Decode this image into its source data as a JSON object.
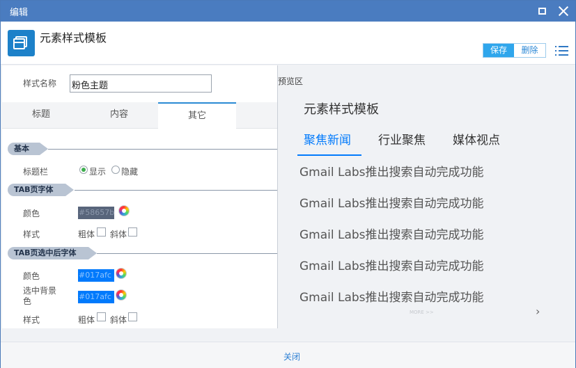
{
  "window": {
    "title": "编辑"
  },
  "header": {
    "title": "元素样式模板",
    "save_label": "保存",
    "delete_label": "删除"
  },
  "form": {
    "name_label": "样式名称",
    "name_value": "粉色主题"
  },
  "tabs": [
    {
      "label": "标题"
    },
    {
      "label": "内容"
    },
    {
      "label": "其它"
    }
  ],
  "sections": {
    "basic": {
      "title": "基本",
      "titlebar_label": "标题栏",
      "show_label": "显示",
      "hide_label": "隐藏"
    },
    "tab_font": {
      "title": "TAB页字体",
      "color_label": "颜色",
      "color_value": "#58657b",
      "style_label": "样式",
      "bold_label": "粗体",
      "italic_label": "斜体"
    },
    "tab_selected_font": {
      "title": "TAB页选中后字体",
      "color_label": "颜色",
      "color_value": "#017afc",
      "bg_label": "选中背景色",
      "bg_value": "#017afc",
      "style_label": "样式",
      "bold_label": "粗体",
      "italic_label": "斜体"
    }
  },
  "preview": {
    "label": "预览区",
    "title": "元素样式模板",
    "tabs": [
      {
        "label": "聚焦新闻"
      },
      {
        "label": "行业聚焦"
      },
      {
        "label": "媒体视点"
      }
    ],
    "items": [
      "Gmail Labs推出搜索自动完成功能",
      "Gmail Labs推出搜索自动完成功能",
      "Gmail Labs推出搜索自动完成功能",
      "Gmail Labs推出搜索自动完成功能",
      "Gmail Labs推出搜索自动完成功能"
    ],
    "more_label": "MORE >>",
    "next_symbol": "›"
  },
  "footer": {
    "close_label": "关闭"
  },
  "colors": {
    "titlebar": "#4a7cc0",
    "accent": "#017afc",
    "save_button": "#2fa6ec",
    "tab_font_color": "#58657b"
  }
}
